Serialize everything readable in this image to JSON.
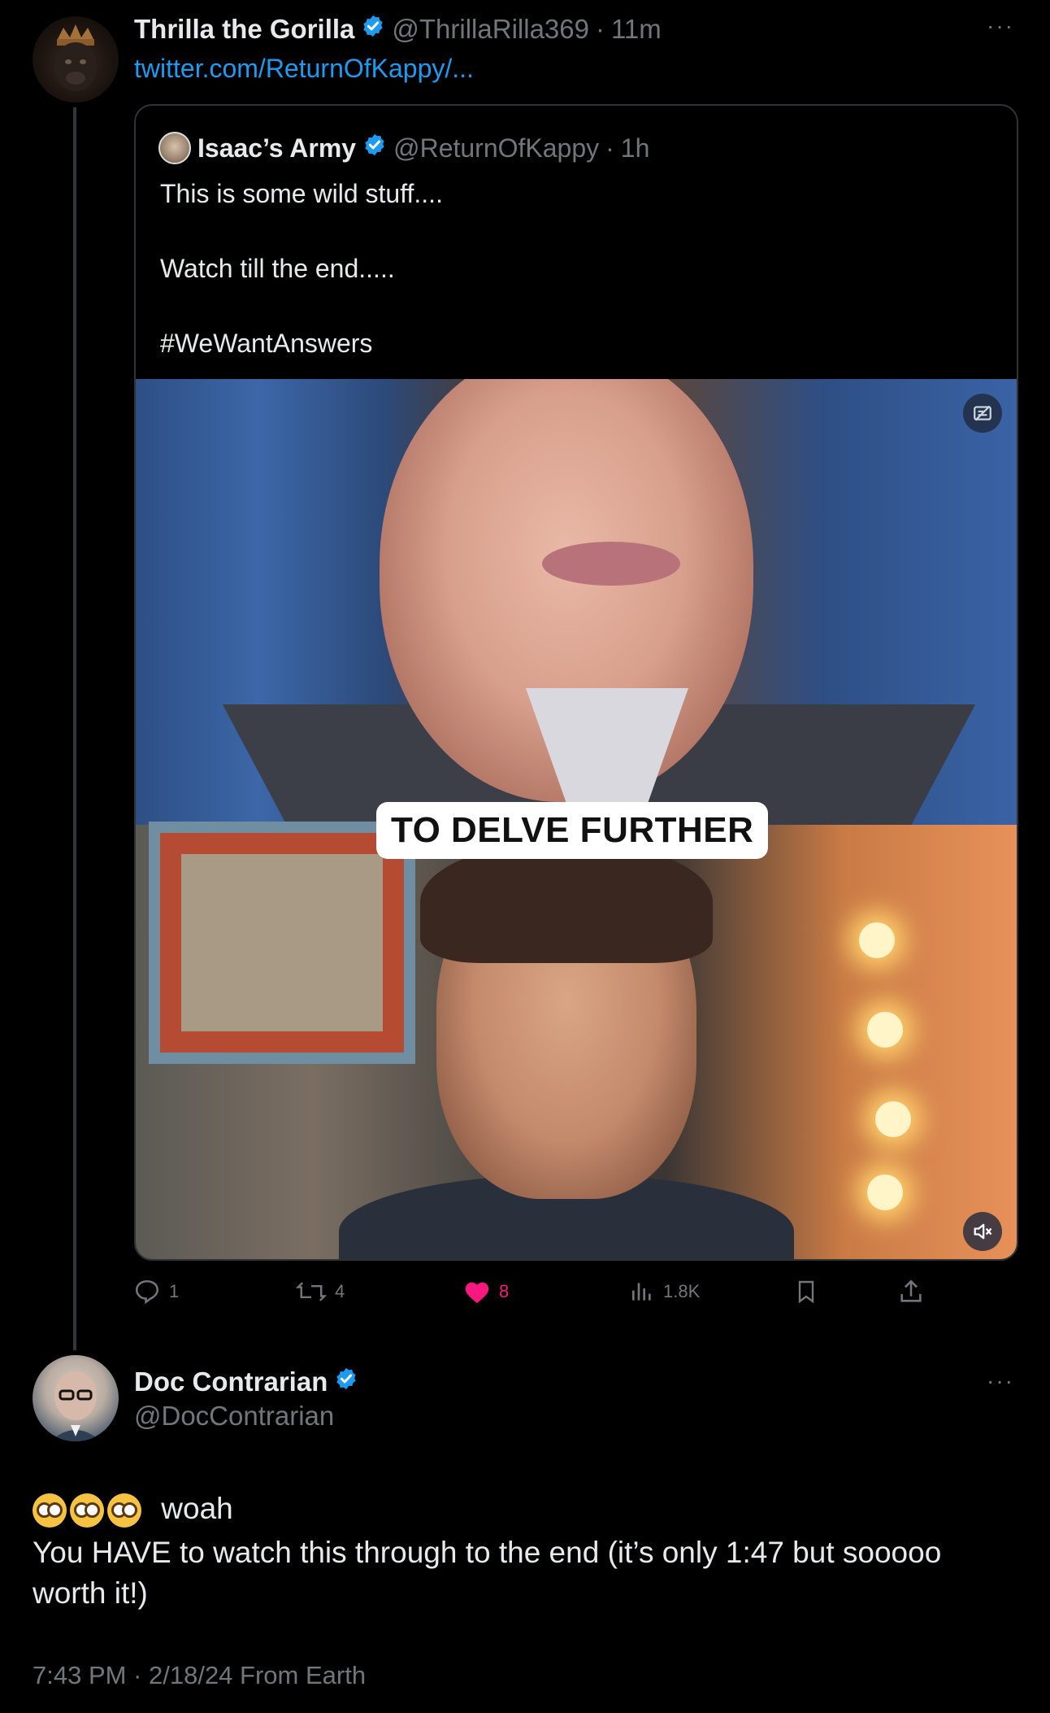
{
  "tweet1": {
    "author_name": "Thrilla the Gorilla",
    "author_handle": "@ThrillaRilla369",
    "separator": "·",
    "time": "11m",
    "link_text": "twitter.com/ReturnOfKappy/...",
    "more": "···",
    "quote": {
      "author_name": "Isaac’s Army",
      "author_handle": "@ReturnOfKappy",
      "separator": "·",
      "time": "1h",
      "lines": [
        "This is some wild stuff....",
        "Watch till the end.....",
        "#WeWantAnswers"
      ],
      "video_caption": "TO DELVE FURTHER"
    },
    "actions": {
      "replies": "1",
      "retweets": "4",
      "likes": "8",
      "views": "1.8K"
    }
  },
  "tweet2": {
    "author_name": "Doc Contrarian",
    "author_handle": "@DocContrarian",
    "more": "···",
    "line1": "woah",
    "line2": "You HAVE to watch this through to the end (it’s only 1:47 but sooooo",
    "line3": "worth it!)",
    "timestamp": "7:43 PM · 2/18/24 From Earth"
  },
  "colors": {
    "background": "#000000",
    "text": "#e7e9ea",
    "muted": "#71767b",
    "link": "#1d9bf0",
    "like": "#f91880",
    "verified": "#1d9bf0",
    "border": "#2f3336"
  },
  "icons": [
    "reply-icon",
    "retweet-icon",
    "like-icon",
    "views-icon",
    "bookmark-icon",
    "share-icon",
    "verified-badge-icon",
    "mute-icon",
    "media-settings-icon"
  ]
}
